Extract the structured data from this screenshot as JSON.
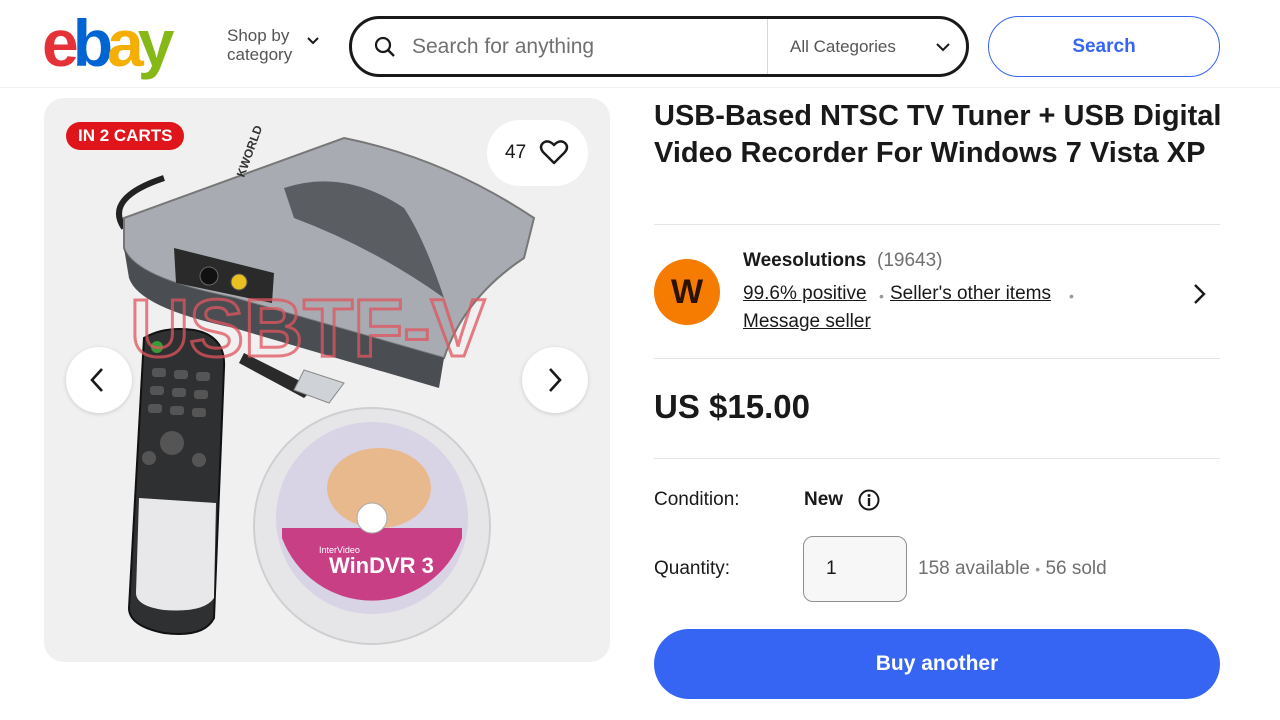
{
  "header": {
    "logo_letters": [
      "e",
      "b",
      "a",
      "y"
    ],
    "shop_by_line1": "Shop by",
    "shop_by_line2": "category",
    "search_placeholder": "Search for anything",
    "category_selected": "All Categories",
    "search_button": "Search"
  },
  "gallery": {
    "badge": "IN 2 CARTS",
    "watch_count": "47",
    "image_text": {
      "watermark": "USBTF-V",
      "device_logo": "KWORLD",
      "disc_brand": "InterVideo",
      "disc_title": "WinDVR 3"
    }
  },
  "listing": {
    "title": "USB-Based NTSC TV Tuner + USB Digital Video Recorder For Windows 7 Vista XP",
    "seller": {
      "avatar_letter": "W",
      "name": "Weesolutions",
      "feedback_count": "(19643)",
      "positive": "99.6% positive",
      "other_items": "Seller's other items",
      "message": "Message seller",
      "separator": "•"
    },
    "price": "US $15.00",
    "condition_label": "Condition:",
    "condition_value": "New",
    "quantity_label": "Quantity:",
    "quantity_value": "1",
    "availability": "158 available",
    "sold": "56 sold",
    "buy_button": "Buy another"
  },
  "colors": {
    "logo_e": "#e53238",
    "logo_b": "#0064d2",
    "logo_a": "#f5af02",
    "logo_y": "#86b817",
    "accent_blue": "#3665f3",
    "badge_red": "#e0151b",
    "avatar_orange": "#f57c00"
  },
  "icons": [
    "search-icon",
    "chevron-down-icon",
    "heart-icon",
    "chevron-left-icon",
    "chevron-right-icon",
    "info-icon"
  ]
}
